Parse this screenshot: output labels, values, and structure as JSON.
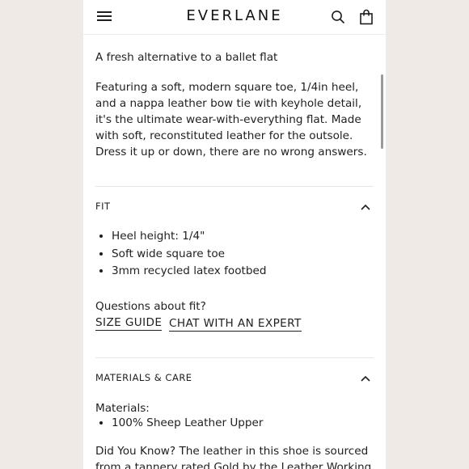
{
  "header": {
    "brand": "EVERLANE"
  },
  "tagline": "A fresh alternative to a ballet flat",
  "description": "Featuring a soft, modern square toe, 1/4in heel, and a nappa leather bow tie with keyhole detail, it's the ultimate wear-with-everything flat. Made with soft, reconstituted leather for the outsole. Dress it up or down, there are no wrong answers.",
  "fit": {
    "title": "FIT",
    "items": [
      "Heel height: 1/4\"",
      "Soft wide square toe",
      "3mm recycled latex footbed"
    ],
    "question": "Questions about fit?",
    "size_guide": "SIZE GUIDE",
    "chat": "CHAT WITH AN EXPERT"
  },
  "materials": {
    "title": "MATERIALS & CARE",
    "label": "Materials:",
    "items": [
      "100% Sheep Leather Upper"
    ],
    "did_you_know": "Did You Know? The leather in this shoe is sourced from a tannery rated Gold by the Leather Working"
  }
}
